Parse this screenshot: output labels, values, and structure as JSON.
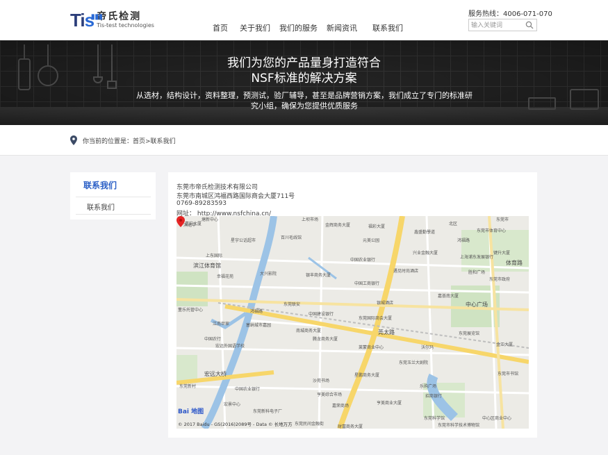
{
  "logo": {
    "mark_main": "Ti",
    "mark_s": "s",
    "cn": "帝氏检测",
    "en": "Tis-test technologies"
  },
  "nav": [
    "首页",
    "关于我们",
    "我们的服务",
    "新闻资讯",
    "联系我们"
  ],
  "hotline": "服务热线：4006-071-070",
  "search": {
    "placeholder": "输入关键词"
  },
  "banner": {
    "title_line1": "我们为您的产品量身打造符合",
    "title_line2": "NSF标准的解决方案",
    "desc": "从选材，结构设计，资料整理，预测试，验厂辅导，甚至是品牌营销方案，我们成立了专门的标准研究小组，确保为您提供优质服务"
  },
  "breadcrumb": "你当前的位置是：首页>联系我们",
  "sidebar": {
    "title": "联系我们",
    "items": [
      "联系我们"
    ]
  },
  "contact": {
    "company": "东莞市帝氏检测技术有限公司",
    "address": "东莞市南城区鸿福西路国际商会大厦711号",
    "phone": "0769-89283593",
    "website": "网址： http://www.nsfchina.cn/"
  },
  "map": {
    "labels": [
      "嘉宏大厦",
      "金辉商务大厦",
      "福彩大厦",
      "北区",
      "东莞市体育中心",
      "塘新中心",
      "滨北中",
      "上坝市场",
      "鑫盛勤學道",
      "东莞市",
      "星宇公话超市",
      "百川毛线馆",
      "元美公园",
      "兴业金融大厦",
      "鸿福路",
      "上东国际",
      "中国农业银行",
      "上海浦东发展银行",
      "键升大厦",
      "滨江体育馆",
      "遇见时尚酒店",
      "胜和广场",
      "体育路",
      "大兴影院",
      "银丰商务大厦",
      "东莞市政府",
      "幸福花苑",
      "中国工商银行",
      "嘉荟南大厦",
      "鸿福路",
      "中心广场",
      "东莞联安",
      "中国建设银行",
      "银城酒店",
      "东莞国际商会大厦",
      "董乐托管中心",
      "江南世家",
      "塞纳城市嘉园",
      "东莞展览馆",
      "南城商务大厦",
      "莞太路",
      "腾龙商务大厦",
      "莱蒙商业中心",
      "沃尔玛",
      "金汇大厦",
      "中国农行",
      "宏远外国语学校",
      "东莞玉兰大剧院",
      "东莞市书馆",
      "宏远大桥",
      "沙苑书场",
      "星鹏商务大厦",
      "东莞科学馆",
      "中国农业银行",
      "乐购广场",
      "亨美综合市场",
      "招商银行",
      "宏景中心",
      "嘉荣商场",
      "亨美商业大厦",
      "东莞新科电子厂",
      "中心区商业中心",
      "东莞民间金融街",
      "东莞市科学技术博物馆",
      "财富商务大厦",
      "东莞新村"
    ],
    "baidu": "Bai 地图",
    "copyright": "© 2017 Baidu - GS(2016)2089号 - Data © 长地万方"
  },
  "colors": {
    "accent": "#2a5fc6",
    "map_road_major": "#f7d66a",
    "map_water": "#9cc3e6",
    "map_green": "#cfe3c2",
    "pin": "#e52424"
  }
}
